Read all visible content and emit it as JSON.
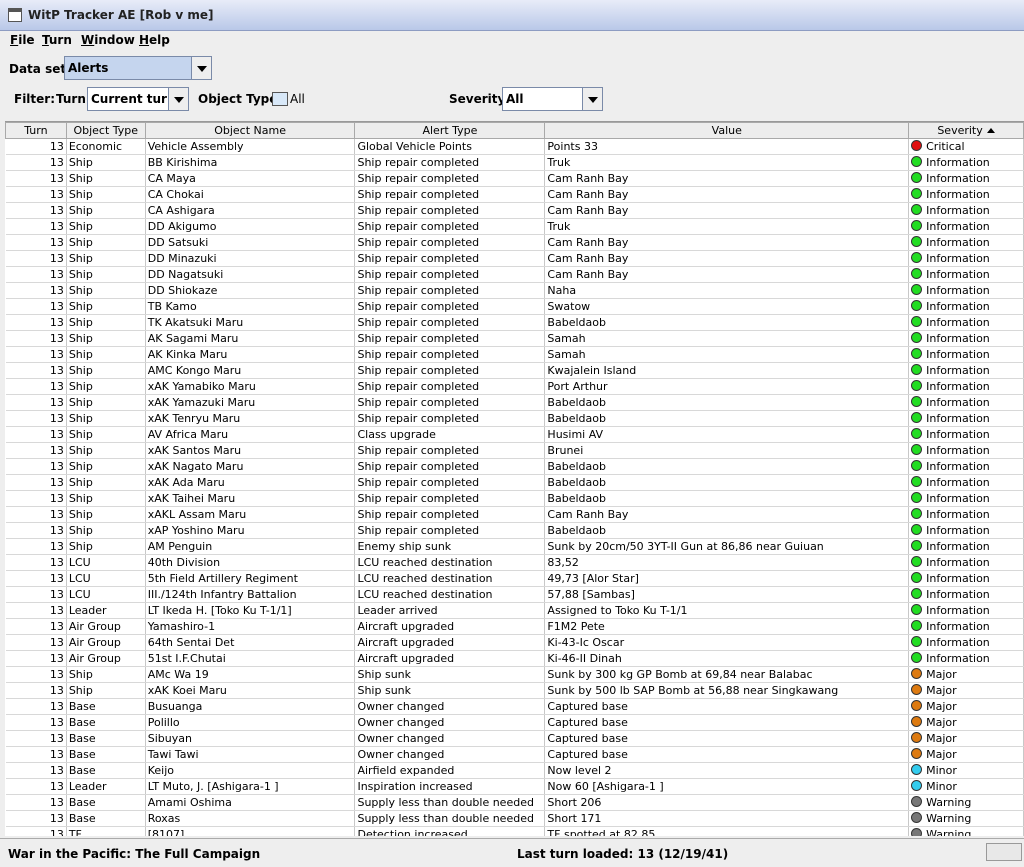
{
  "app": {
    "title": "WitP Tracker AE [Rob v me]"
  },
  "menu": [
    "File",
    "Turn",
    "Window",
    "Help"
  ],
  "dataset": {
    "label": "Data set:",
    "value": "Alerts"
  },
  "filter": {
    "label": "Filter:",
    "turn_label": "Turn:",
    "turn_value": "Current turn",
    "object_type_label": "Object Type:",
    "object_type_value": "All",
    "severity_label": "Severity:",
    "severity_value": "All"
  },
  "table": {
    "columns": [
      "Turn",
      "Object Type",
      "Object Name",
      "Alert Type",
      "Value",
      "Severity"
    ],
    "rows": [
      [
        "13",
        "Economic",
        "Vehicle Assembly",
        "Global Vehicle Points",
        "Points 33",
        "Critical"
      ],
      [
        "13",
        "Ship",
        "BB Kirishima",
        "Ship repair completed",
        "Truk",
        "Information"
      ],
      [
        "13",
        "Ship",
        "CA Maya",
        "Ship repair completed",
        "Cam Ranh Bay",
        "Information"
      ],
      [
        "13",
        "Ship",
        "CA Chokai",
        "Ship repair completed",
        "Cam Ranh Bay",
        "Information"
      ],
      [
        "13",
        "Ship",
        "CA Ashigara",
        "Ship repair completed",
        "Cam Ranh Bay",
        "Information"
      ],
      [
        "13",
        "Ship",
        "DD Akigumo",
        "Ship repair completed",
        "Truk",
        "Information"
      ],
      [
        "13",
        "Ship",
        "DD Satsuki",
        "Ship repair completed",
        "Cam Ranh Bay",
        "Information"
      ],
      [
        "13",
        "Ship",
        "DD Minazuki",
        "Ship repair completed",
        "Cam Ranh Bay",
        "Information"
      ],
      [
        "13",
        "Ship",
        "DD Nagatsuki",
        "Ship repair completed",
        "Cam Ranh Bay",
        "Information"
      ],
      [
        "13",
        "Ship",
        "DD Shiokaze",
        "Ship repair completed",
        "Naha",
        "Information"
      ],
      [
        "13",
        "Ship",
        "TB Kamo",
        "Ship repair completed",
        "Swatow",
        "Information"
      ],
      [
        "13",
        "Ship",
        "TK Akatsuki Maru",
        "Ship repair completed",
        "Babeldaob",
        "Information"
      ],
      [
        "13",
        "Ship",
        "AK Sagami Maru",
        "Ship repair completed",
        "Samah",
        "Information"
      ],
      [
        "13",
        "Ship",
        "AK Kinka Maru",
        "Ship repair completed",
        "Samah",
        "Information"
      ],
      [
        "13",
        "Ship",
        "AMC Kongo Maru",
        "Ship repair completed",
        "Kwajalein Island",
        "Information"
      ],
      [
        "13",
        "Ship",
        "xAK Yamabiko Maru",
        "Ship repair completed",
        "Port Arthur",
        "Information"
      ],
      [
        "13",
        "Ship",
        "xAK Yamazuki Maru",
        "Ship repair completed",
        "Babeldaob",
        "Information"
      ],
      [
        "13",
        "Ship",
        "xAK Tenryu Maru",
        "Ship repair completed",
        "Babeldaob",
        "Information"
      ],
      [
        "13",
        "Ship",
        "AV Africa Maru",
        "Class upgrade",
        "Husimi AV",
        "Information"
      ],
      [
        "13",
        "Ship",
        "xAK Santos Maru",
        "Ship repair completed",
        "Brunei",
        "Information"
      ],
      [
        "13",
        "Ship",
        "xAK Nagato Maru",
        "Ship repair completed",
        "Babeldaob",
        "Information"
      ],
      [
        "13",
        "Ship",
        "xAK Ada Maru",
        "Ship repair completed",
        "Babeldaob",
        "Information"
      ],
      [
        "13",
        "Ship",
        "xAK Taihei Maru",
        "Ship repair completed",
        "Babeldaob",
        "Information"
      ],
      [
        "13",
        "Ship",
        "xAKL Assam Maru",
        "Ship repair completed",
        "Cam Ranh Bay",
        "Information"
      ],
      [
        "13",
        "Ship",
        "xAP Yoshino Maru",
        "Ship repair completed",
        "Babeldaob",
        "Information"
      ],
      [
        "13",
        "Ship",
        "AM Penguin",
        "Enemy ship sunk",
        "Sunk by 20cm/50 3YT-II Gun at 86,86 near Guiuan",
        "Information"
      ],
      [
        "13",
        "LCU",
        "40th Division",
        "LCU reached destination",
        "83,52",
        "Information"
      ],
      [
        "13",
        "LCU",
        "5th Field Artillery Regiment",
        "LCU reached destination",
        "49,73 [Alor Star]",
        "Information"
      ],
      [
        "13",
        "LCU",
        "III./124th Infantry Battalion",
        "LCU reached destination",
        "57,88 [Sambas]",
        "Information"
      ],
      [
        "13",
        "Leader",
        "LT Ikeda H. [Toko Ku T-1/1]",
        "Leader arrived",
        "Assigned to Toko Ku T-1/1",
        "Information"
      ],
      [
        "13",
        "Air Group",
        "Yamashiro-1",
        "Aircraft upgraded",
        "F1M2 Pete",
        "Information"
      ],
      [
        "13",
        "Air Group",
        "64th Sentai Det",
        "Aircraft upgraded",
        "Ki-43-Ic Oscar",
        "Information"
      ],
      [
        "13",
        "Air Group",
        "51st I.F.Chutai",
        "Aircraft upgraded",
        "Ki-46-II Dinah",
        "Information"
      ],
      [
        "13",
        "Ship",
        "AMc Wa 19",
        "Ship sunk",
        "Sunk by 300 kg GP Bomb at 69,84 near Balabac",
        "Major"
      ],
      [
        "13",
        "Ship",
        "xAK Koei Maru",
        "Ship sunk",
        "Sunk by 500 lb SAP Bomb at 56,88 near Singkawang",
        "Major"
      ],
      [
        "13",
        "Base",
        "Busuanga",
        "Owner changed",
        "Captured base",
        "Major"
      ],
      [
        "13",
        "Base",
        "Polillo",
        "Owner changed",
        "Captured base",
        "Major"
      ],
      [
        "13",
        "Base",
        "Sibuyan",
        "Owner changed",
        "Captured base",
        "Major"
      ],
      [
        "13",
        "Base",
        "Tawi Tawi",
        "Owner changed",
        "Captured base",
        "Major"
      ],
      [
        "13",
        "Base",
        "Keijo",
        "Airfield expanded",
        "Now level 2",
        "Minor"
      ],
      [
        "13",
        "Leader",
        "LT Muto, J. [Ashigara-1 ]",
        "Inspiration increased",
        "Now 60 [Ashigara-1 ]",
        "Minor"
      ],
      [
        "13",
        "Base",
        "Amami Oshima",
        "Supply less than double needed",
        "Short 206",
        "Warning"
      ],
      [
        "13",
        "Base",
        "Roxas",
        "Supply less than double needed",
        "Short 171",
        "Warning"
      ],
      [
        "13",
        "TF",
        "[8107]",
        "Detection increased",
        "TF spotted at 82,85",
        "Warning"
      ]
    ]
  },
  "severity_colors": {
    "Critical": "#e01010",
    "Information": "#22dd22",
    "Major": "#dd7a10",
    "Minor": "#33ccee",
    "Warning": "#777777"
  },
  "status": {
    "left": "War in the Pacific: The Full Campaign",
    "mid": "Last turn loaded: 13 (12/19/41)"
  }
}
